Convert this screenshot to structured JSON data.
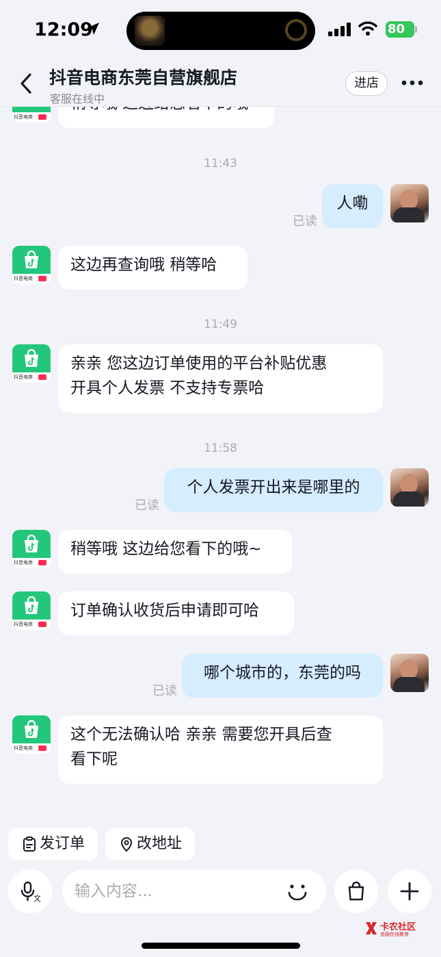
{
  "status_bar": {
    "time": "12:09",
    "battery": "80"
  },
  "header": {
    "shop_name": "抖音电商东莞自营旗舰店",
    "status": "客服在线中",
    "enter_label": "进店"
  },
  "shop_avatar_label": "抖音电商",
  "messages": [
    {
      "side": "in",
      "text": "稍等哦 这边给您看下的哦~"
    },
    {
      "timestamp": "11:43"
    },
    {
      "side": "out",
      "text": "人嘞",
      "read": "已读"
    },
    {
      "side": "in",
      "text": "这边再查询哦 稍等哈"
    },
    {
      "timestamp": "11:49"
    },
    {
      "side": "in",
      "text_line1": "亲亲 您这边订单使用的平台补贴优惠",
      "text_line2": "开具个人发票 不支持专票哈"
    },
    {
      "timestamp": "11:58"
    },
    {
      "side": "out",
      "text": "个人发票开出来是哪里的",
      "read": "已读"
    },
    {
      "side": "in",
      "text": "稍等哦 这边给您看下的哦~"
    },
    {
      "side": "in",
      "text": "订单确认收货后申请即可哈"
    },
    {
      "side": "out",
      "text": "哪个城市的，东莞的吗",
      "read": "已读"
    },
    {
      "side": "in",
      "text_line1": "这个无法确认哈 亲亲 需要您开具后查",
      "text_line2": "看下呢"
    }
  ],
  "quick_actions": {
    "send_order": "发订单",
    "change_address": "改地址"
  },
  "input": {
    "placeholder": "输入内容..."
  },
  "watermark": {
    "title": "卡农社区",
    "subtitle": "金融在线教育"
  },
  "colors": {
    "accent_green": "#22c77c",
    "bubble_out": "#d6ecff",
    "bubble_in": "#ffffff",
    "background": "#f1f3f8"
  }
}
